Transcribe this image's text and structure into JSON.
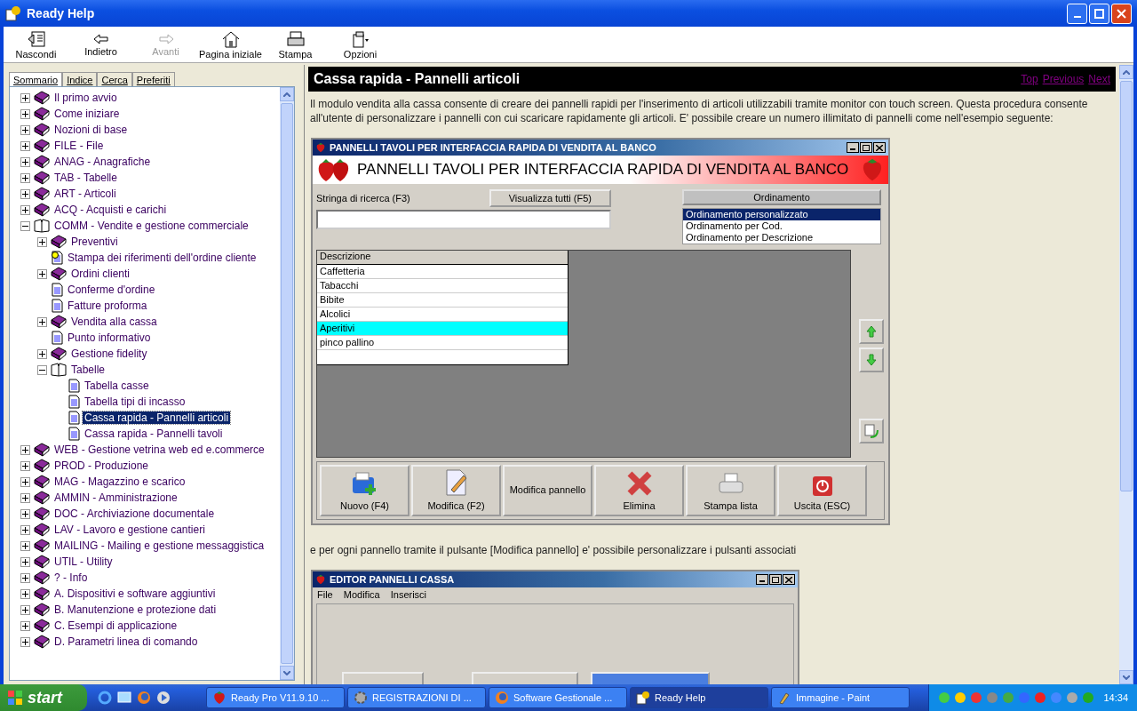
{
  "window": {
    "title": "Ready Help"
  },
  "toolbar": [
    {
      "label": "Nascondi",
      "kind": "hide",
      "disabled": false
    },
    {
      "label": "Indietro",
      "kind": "back",
      "disabled": false
    },
    {
      "label": "Avanti",
      "kind": "forward",
      "disabled": true
    },
    {
      "label": "Pagina iniziale",
      "kind": "home",
      "disabled": false
    },
    {
      "label": "Stampa",
      "kind": "print",
      "disabled": false
    },
    {
      "label": "Opzioni",
      "kind": "options",
      "disabled": false
    }
  ],
  "tabs": [
    {
      "label": "Sommario",
      "selected": true
    },
    {
      "label": "Indice",
      "selected": false
    },
    {
      "label": "Cerca",
      "selected": false
    },
    {
      "label": "Preferiti",
      "selected": false
    }
  ],
  "tree": [
    {
      "label": "Il primo avvio",
      "kind": "book",
      "expanded": false,
      "selected": false
    },
    {
      "label": "Come iniziare",
      "kind": "book",
      "expanded": false,
      "selected": false
    },
    {
      "label": "Nozioni di base",
      "kind": "book",
      "expanded": false,
      "selected": false
    },
    {
      "label": "FILE - File",
      "kind": "book",
      "expanded": false,
      "selected": false
    },
    {
      "label": "ANAG - Anagrafiche",
      "kind": "book",
      "expanded": false,
      "selected": false
    },
    {
      "label": "TAB - Tabelle",
      "kind": "book",
      "expanded": false,
      "selected": false
    },
    {
      "label": "ART - Articoli",
      "kind": "book",
      "expanded": false,
      "selected": false
    },
    {
      "label": "ACQ -  Acquisti e carichi",
      "kind": "book",
      "expanded": false,
      "selected": false
    },
    {
      "label": "COMM - Vendite e gestione commerciale",
      "kind": "book",
      "expanded": true,
      "selected": false,
      "children": [
        {
          "label": "Preventivi",
          "kind": "book",
          "expanded": false,
          "selected": false
        },
        {
          "label": "Stampa dei riferimenti dell'ordine cliente",
          "kind": "tip",
          "selected": false
        },
        {
          "label": "Ordini clienti",
          "kind": "book",
          "expanded": false,
          "selected": false
        },
        {
          "label": "Conferme d'ordine",
          "kind": "page",
          "selected": false
        },
        {
          "label": "Fatture proforma",
          "kind": "page",
          "selected": false
        },
        {
          "label": "Vendita alla cassa",
          "kind": "book",
          "expanded": false,
          "selected": false
        },
        {
          "label": "Punto informativo",
          "kind": "page",
          "selected": false
        },
        {
          "label": "Gestione fidelity",
          "kind": "book",
          "expanded": false,
          "selected": false
        },
        {
          "label": "Tabelle",
          "kind": "book",
          "expanded": true,
          "selected": false,
          "children": [
            {
              "label": "Tabella casse",
              "kind": "page",
              "selected": false
            },
            {
              "label": "Tabella tipi di incasso",
              "kind": "page",
              "selected": false
            },
            {
              "label": "Cassa rapida - Pannelli articoli",
              "kind": "page",
              "selected": true
            },
            {
              "label": "Cassa rapida - Pannelli tavoli",
              "kind": "page",
              "selected": false
            }
          ]
        }
      ]
    },
    {
      "label": "WEB - Gestione vetrina web ed e.commerce",
      "kind": "book",
      "expanded": false,
      "selected": false
    },
    {
      "label": "PROD - Produzione",
      "kind": "book",
      "expanded": false,
      "selected": false
    },
    {
      "label": "MAG - Magazzino e scarico",
      "kind": "book",
      "expanded": false,
      "selected": false
    },
    {
      "label": "AMMIN - Amministrazione",
      "kind": "book",
      "expanded": false,
      "selected": false
    },
    {
      "label": "DOC - Archiviazione documentale",
      "kind": "book",
      "expanded": false,
      "selected": false
    },
    {
      "label": "LAV - Lavoro e gestione cantieri",
      "kind": "book",
      "expanded": false,
      "selected": false
    },
    {
      "label": "MAILING - Mailing e gestione messaggistica",
      "kind": "book",
      "expanded": false,
      "selected": false
    },
    {
      "label": "UTIL - Utility",
      "kind": "book",
      "expanded": false,
      "selected": false
    },
    {
      "label": "? - Info",
      "kind": "book",
      "expanded": false,
      "selected": false
    },
    {
      "label": "A. Dispositivi e software aggiuntivi",
      "kind": "book",
      "expanded": false,
      "selected": false
    },
    {
      "label": "B. Manutenzione e protezione dati",
      "kind": "book",
      "expanded": false,
      "selected": false
    },
    {
      "label": "C. Esempi di applicazione",
      "kind": "book",
      "expanded": false,
      "selected": false
    },
    {
      "label": "D. Parametri linea di comando",
      "kind": "book",
      "expanded": false,
      "selected": false
    }
  ],
  "topic": {
    "title": "Cassa rapida - Pannelli articoli",
    "links": [
      "Top",
      "Previous",
      "Next"
    ],
    "intro": "Il modulo vendita alla cassa consente di creare dei pannelli rapidi per l'inserimento di articoli utilizzabili tramite monitor con touch screen. Questa procedura consente all'utente di personalizzare i pannelli con cui scaricare rapidamente gli articoli. E' possibile creare un numero illimitato di pannelli come nell'esempio seguente:",
    "panel_window": {
      "title": "PANNELLI TAVOLI PER INTERFACCIA RAPIDA DI VENDITA AL BANCO",
      "banner": "PANNELLI TAVOLI PER INTERFACCIA RAPIDA DI VENDITA AL BANCO",
      "search_label": "Stringa di ricerca (F3)",
      "show_all": "Visualizza tutti (F5)",
      "sort_title": "Ordinamento",
      "sort_options": [
        {
          "label": "Ordinamento personalizzato",
          "selected": true
        },
        {
          "label": "Ordinamento per Cod.",
          "selected": false
        },
        {
          "label": "Ordinamento per Descrizione",
          "selected": false
        }
      ],
      "grid_header": "Descrizione",
      "rows": [
        {
          "label": "Caffetteria",
          "selected": false
        },
        {
          "label": "Tabacchi",
          "selected": false
        },
        {
          "label": "Bibite",
          "selected": false
        },
        {
          "label": "Alcolici",
          "selected": false
        },
        {
          "label": "Aperitivi",
          "selected": true
        },
        {
          "label": "pinco pallino",
          "selected": false
        }
      ],
      "buttons": [
        {
          "label": "Nuovo (F4)",
          "kind": "new"
        },
        {
          "label": "Modifica (F2)",
          "kind": "edit"
        },
        {
          "label": "Modifica pannello",
          "kind": "text"
        },
        {
          "label": "Elimina",
          "kind": "delete"
        },
        {
          "label": "Stampa lista",
          "kind": "print"
        },
        {
          "label": "Uscita (ESC)",
          "kind": "exit"
        }
      ]
    },
    "caption": "e per ogni pannello tramite il pulsante [Modifica pannello] e' possibile personalizzare i pulsanti associati",
    "editor_window": {
      "title": "EDITOR PANNELLI CASSA",
      "menu": [
        "File",
        "Modifica",
        "Inserisci"
      ]
    }
  },
  "taskbar": {
    "start": "start",
    "tasks": [
      {
        "label": "Ready Pro V11.9.10 ...",
        "kind": "app",
        "selected": false
      },
      {
        "label": "REGISTRAZIONI DI ...",
        "kind": "gear",
        "selected": false
      },
      {
        "label": "Software Gestionale ...",
        "kind": "browser",
        "selected": false
      },
      {
        "label": "Ready Help",
        "kind": "help",
        "selected": true
      },
      {
        "label": "Immagine - Paint",
        "kind": "paint",
        "selected": false
      }
    ],
    "clock": "14:34"
  }
}
